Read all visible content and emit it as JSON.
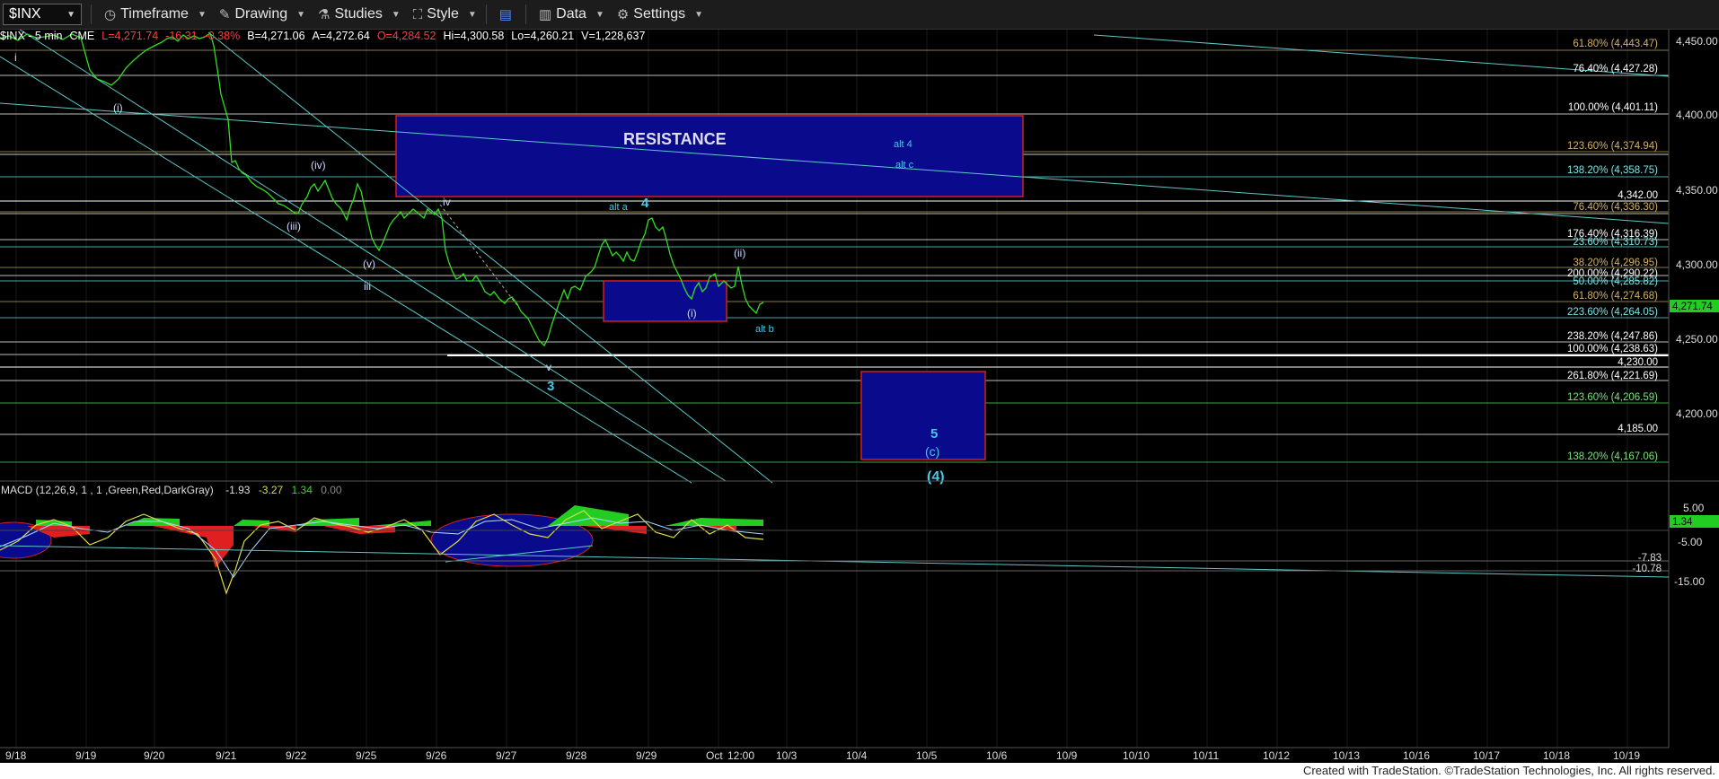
{
  "toolbar": {
    "symbol": "$INX",
    "timeframe": "Timeframe",
    "drawing": "Drawing",
    "studies": "Studies",
    "style": "Style",
    "data": "Data",
    "settings": "Settings"
  },
  "infobar": {
    "symbol": "$INX - 5 min",
    "exchange": "CME",
    "last": "L=4,271.74",
    "change": "-16.31",
    "pct": "-0.38%",
    "bid": "B=4,271.06",
    "ask": "A=4,272.64",
    "open": "O=4,284.52",
    "high": "Hi=4,300.58",
    "low": "Lo=4,260.21",
    "volume": "V=1,228,637"
  },
  "colors": {
    "bg": "#000000",
    "price": "#33dd22",
    "fib_green": "#7ee07e",
    "fib_orange": "#d4b26a",
    "fib_cyan": "#7fe3e3",
    "box": "#0a0a8c",
    "box_border": "#d02020",
    "wave_label": "#48c8e8"
  },
  "price_axis": {
    "ticks": [
      "4,450.00",
      "4,400.00",
      "4,350.00",
      "4,300.00",
      "4,250.00",
      "4,200.00"
    ],
    "current": "4,271.74"
  },
  "fib_labels": [
    {
      "text": "61.80% (4,443.47)",
      "color": "#d4b26a"
    },
    {
      "text": "76.40% (4,427.28)",
      "color": "#ffffff"
    },
    {
      "text": "100.00% (4,401.11)",
      "color": "#ffffff"
    },
    {
      "text": "123.60% (4,374.94)",
      "color": "#d4b26a"
    },
    {
      "text": "138.20% (4,358.75)",
      "color": "#7fe3e3"
    },
    {
      "text": "4,342.00",
      "color": "#ffffff"
    },
    {
      "text": "76.40% (4,336.30)",
      "color": "#d4b26a"
    },
    {
      "text": "176.40% (4,316.39)",
      "color": "#ffffff"
    },
    {
      "text": "23.60% (4,310.73)",
      "color": "#7fe3e3"
    },
    {
      "text": "38.20% (4,296.95)",
      "color": "#d4b26a"
    },
    {
      "text": "200.00% (4,290.22)",
      "color": "#ffffff"
    },
    {
      "text": "50.00% (4,285.82)",
      "color": "#7fe3e3"
    },
    {
      "text": "61.80% (4,274.68)",
      "color": "#d4b26a"
    },
    {
      "text": "223.60% (4,264.05)",
      "color": "#7fe3e3"
    },
    {
      "text": "238.20% (4,247.86)",
      "color": "#ffffff"
    },
    {
      "text": "100.00% (4,238.63)",
      "color": "#ffffff"
    },
    {
      "text": "4,230.00",
      "color": "#ffffff"
    },
    {
      "text": "261.80% (4,221.69)",
      "color": "#ffffff"
    },
    {
      "text": "123.60% (4,206.59)",
      "color": "#7ee07e"
    },
    {
      "text": "4,185.00",
      "color": "#ffffff"
    },
    {
      "text": "138.20% (4,167.06)",
      "color": "#7ee07e"
    }
  ],
  "annotations": {
    "resistance": "RESISTANCE",
    "alt4": "alt 4",
    "altc": "alt c",
    "alta": "alt a",
    "altb": "alt b",
    "w4": "4",
    "w3": "3",
    "w5": "5",
    "wc": "(c)",
    "w4p": "(4)",
    "i": "i",
    "i_paren": "(i)",
    "iii": "(iii)",
    "iv_paren": "(iv)",
    "v_paren": "(v)",
    "iii_small": "iii",
    "iv": "iv",
    "v": "v",
    "i2": "(i)",
    "ii2": "(ii)"
  },
  "macd": {
    "label": "MACD (12,26,9, 1 , 1 ,Green,Red,DarkGray)",
    "v1": "-1.93",
    "v2": "-3.27",
    "v3": "1.34",
    "v4": "0.00",
    "axis": [
      "5.00",
      "-5.00",
      "-15.00"
    ],
    "current": "1.34",
    "levels": [
      "-7.83",
      "-10.78"
    ]
  },
  "time_axis": [
    "9/18",
    "9/19",
    "9/20",
    "9/21",
    "9/22",
    "9/25",
    "9/26",
    "9/27",
    "9/28",
    "9/29",
    "Oct",
    "12:00",
    "10/3",
    "10/4",
    "10/5",
    "10/6",
    "10/9",
    "10/10",
    "10/11",
    "10/12",
    "10/13",
    "10/16",
    "10/17",
    "10/18",
    "10/19"
  ],
  "footer": "Created with TradeStation. ©TradeStation Technologies, Inc. All rights reserved."
}
